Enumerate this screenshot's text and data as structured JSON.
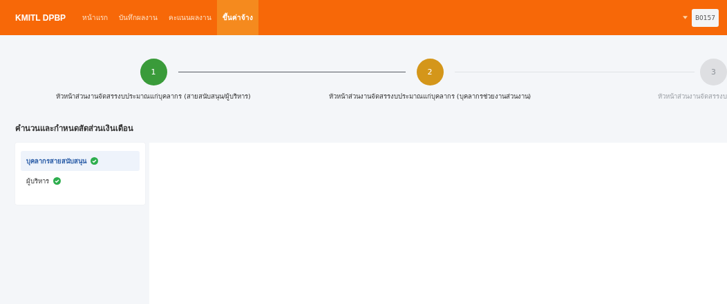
{
  "header": {
    "brand": "KMITL DPBP",
    "nav": [
      {
        "label": "หน้าแรก",
        "selected": false
      },
      {
        "label": "บันทึกผลงาน",
        "selected": false
      },
      {
        "label": "คะแนนผลงาน",
        "selected": false
      },
      {
        "label": "ขึ้นค่าจ้าง",
        "selected": true
      }
    ],
    "user": "B0157"
  },
  "steps": [
    {
      "number": "1",
      "label": "หัวหน้าส่วนงานจัดสรรงบประมาณแก่บุคลากร (สายสนับสนุน/ผู้บริหาร)",
      "done": true,
      "current": false
    },
    {
      "number": "2",
      "label": "หัวหน้าส่วนงานจัดสรรงบประมาณแก่บุคลากร (บุคลากรช่วยงานส่วนงาน)",
      "done": false,
      "current": true
    },
    {
      "number": "3",
      "label": "หัวหน้าส่วนงานจัดสรรงบ",
      "done": false,
      "current": false
    }
  ],
  "section_title": "คำนวนและกำหนดสัดส่วนเงินเดือน",
  "sidebar": {
    "items": [
      {
        "label": "บุคลากรสายสนับสนุน",
        "selected": true,
        "done": true
      },
      {
        "label": "ผู้บริหาร",
        "selected": false,
        "done": true
      }
    ]
  }
}
